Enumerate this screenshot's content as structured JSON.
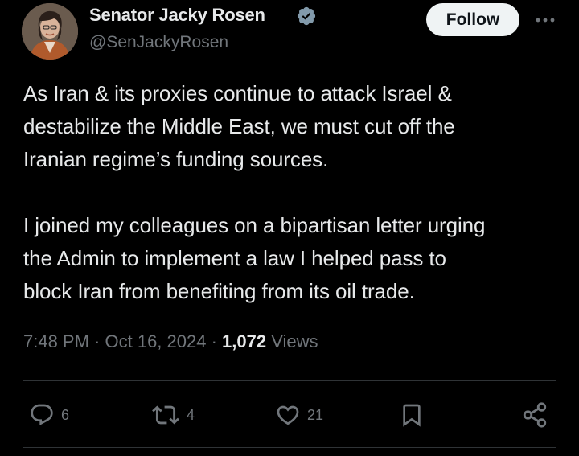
{
  "author": {
    "display_name": "Senator Jacky Rosen",
    "handle": "@SenJackyRosen",
    "verified": true,
    "verified_color": "#829aab"
  },
  "header": {
    "follow_label": "Follow",
    "more_icon": "more-horizontal-icon"
  },
  "tweet": {
    "paragraphs": [
      "As Iran & its proxies continue to attack Israel &\ndestabilize the Middle East, we must cut off the\nIranian regime’s funding sources.",
      "I joined my colleagues on a bipartisan letter urging\nthe Admin to implement a law I helped pass to\nblock Iran from benefiting from its oil trade."
    ]
  },
  "meta": {
    "time": "7:48 PM",
    "separator": " · ",
    "date": "Oct 16, 2024",
    "views_count": "1,072",
    "views_label": "Views"
  },
  "actions": {
    "reply": {
      "icon": "reply-icon",
      "count": "6"
    },
    "repost": {
      "icon": "repost-icon",
      "count": "4"
    },
    "like": {
      "icon": "like-heart-icon",
      "count": "21"
    },
    "bookmark": {
      "icon": "bookmark-icon"
    },
    "share": {
      "icon": "share-icon"
    }
  },
  "colors": {
    "background": "#000000",
    "text_primary": "#e7e9ea",
    "text_secondary": "#71767b",
    "follow_bg": "#eff3f4",
    "divider": "#2f3336"
  }
}
